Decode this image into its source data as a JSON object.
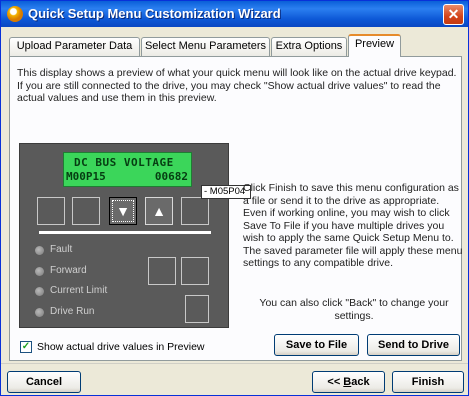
{
  "window": {
    "title": "Quick Setup Menu Customization Wizard",
    "close_glyph": "✕"
  },
  "tabs": [
    {
      "label": "Upload Parameter Data"
    },
    {
      "label": "Select Menu Parameters"
    },
    {
      "label": "Extra Options"
    },
    {
      "label": "Preview",
      "active": true
    }
  ],
  "description": "This display shows a preview of what your quick menu will look like on the actual drive keypad. If you are still connected to the drive, you may check \"Show actual drive values\" to read the actual values and use them in this preview.",
  "keypad": {
    "lcd_line1": "DC BUS VOLTAGE",
    "lcd_param": "M00P15",
    "lcd_value": "00682",
    "param_tag": "- M05P04",
    "down_glyph": "▼",
    "up_glyph": "▲",
    "leds": [
      {
        "label": "Fault"
      },
      {
        "label": "Forward"
      },
      {
        "label": "Current Limit"
      },
      {
        "label": "Drive Run"
      }
    ]
  },
  "info_text": "Click Finish to save this menu configuration as a file or send it to the drive as appropriate. Even if working online, you may wish to click Save To File if you have multiple drives you wish to apply the same Quick Setup Menu to. The saved parameter file will apply these menu settings to any compatible drive.",
  "info_text2": "You can also click \"Back\" to change your settings.",
  "show_actual": {
    "label": "Show actual drive values in Preview",
    "checked": true,
    "check_glyph": "✓"
  },
  "buttons": {
    "save_to_file": "Save to File",
    "send_to_drive": "Send to Drive",
    "cancel": "Cancel",
    "back_prefix": "<< ",
    "back_underlined": "B",
    "back_rest": "ack",
    "finish": "Finish"
  }
}
